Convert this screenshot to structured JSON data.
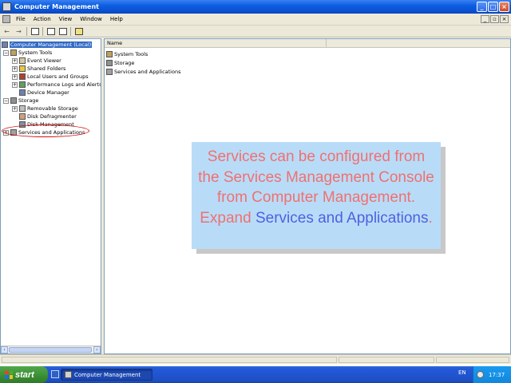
{
  "window": {
    "title": "Computer Management",
    "min": "_",
    "max": "□",
    "close": "×"
  },
  "menu": {
    "items": [
      "File",
      "Action",
      "View",
      "Window",
      "Help"
    ]
  },
  "tree": {
    "root": "Computer Management (Local)",
    "system_tools": "System Tools",
    "event_viewer": "Event Viewer",
    "shared_folders": "Shared Folders",
    "local_users": "Local Users and Groups",
    "perf_logs": "Performance Logs and Alerts",
    "device_manager": "Device Manager",
    "storage": "Storage",
    "removable_storage": "Removable Storage",
    "disk_defrag": "Disk Defragmenter",
    "disk_management": "Disk Management",
    "services_apps": "Services and Applications"
  },
  "list": {
    "column_name": "Name",
    "rows": [
      "System Tools",
      "Storage",
      "Services and Applications"
    ]
  },
  "callout": {
    "part1": "Services can be configured from the Services Management Console from Computer Management. Expand ",
    "part2": "Services and Applications",
    "part3": "."
  },
  "taskbar": {
    "start": "start",
    "task_label": "Computer Management",
    "lang": "EN",
    "clock": "17:37"
  },
  "colors": {
    "callout_bg": "#b8dcf8",
    "callout_text": "#f07070",
    "callout_highlight": "#5060e0",
    "annotation_ellipse": "#d01010",
    "titlebar": "#0c5fe0"
  }
}
